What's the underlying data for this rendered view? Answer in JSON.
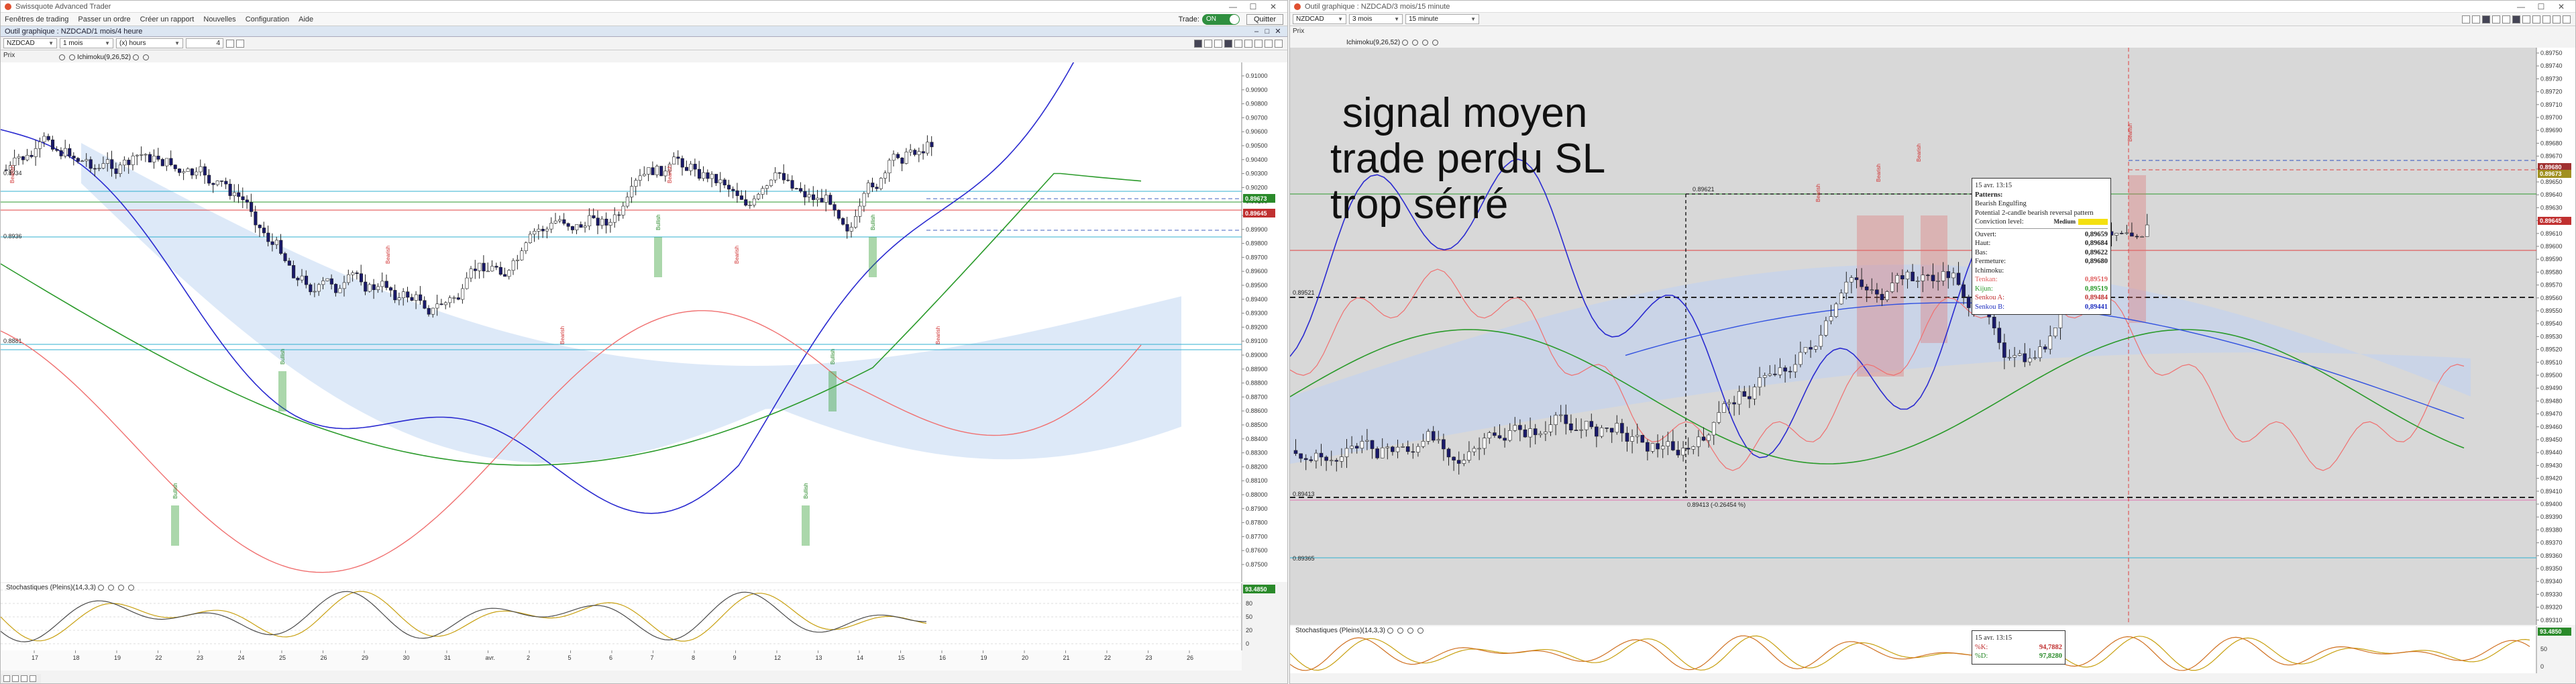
{
  "left": {
    "app_title": "Swissquote Advanced Trader",
    "menu": [
      "Fenêtres de trading",
      "Passer un ordre",
      "Créer un rapport",
      "Nouvelles",
      "Configuration",
      "Aide"
    ],
    "trade_label": "Trade:",
    "trade_state": "ON",
    "quit_label": "Quitter",
    "chart_title": "Outil graphique : NZDCAD/1 mois/4 heure",
    "symbol": "NZDCAD",
    "period": "1 mois",
    "unit": "(x) hours",
    "unit_value": "4",
    "price_label": "Prix",
    "ichimoku_label": "Ichimoku(9,26,52)",
    "stoch_label": "Stochastiques (Pleins)(14,3,3)",
    "price_ticks": [
      "0.91000",
      "0.90900",
      "0.90800",
      "0.90700",
      "0.90600",
      "0.90500",
      "0.90400",
      "0.90300",
      "0.90200",
      "0.90100",
      "0.90000",
      "0.89900",
      "0.89800",
      "0.89700",
      "0.89600",
      "0.89500",
      "0.89400",
      "0.89300",
      "0.89200",
      "0.89100",
      "0.89000",
      "0.88900",
      "0.88800",
      "0.88700",
      "0.88600",
      "0.88500",
      "0.88400",
      "0.88300",
      "0.88200",
      "0.88100",
      "0.88000",
      "0.87900",
      "0.87800",
      "0.87700",
      "0.87600",
      "0.87500"
    ],
    "level_labels": [
      "0.8934",
      "0.8936",
      "0.8881"
    ],
    "price_badges": [
      {
        "text": "0.89673",
        "color": "#2a8a2a"
      },
      {
        "text": "0.89645",
        "color": "#c03030"
      }
    ],
    "stoch_ticks": [
      "100",
      "80",
      "50",
      "20",
      "0"
    ],
    "stoch_badge": "93.4850",
    "date_ticks": [
      "17",
      "18",
      "19",
      "22",
      "23",
      "24",
      "25",
      "26",
      "29",
      "30",
      "31",
      "avr.",
      "2",
      "5",
      "6",
      "7",
      "8",
      "9",
      "12",
      "13",
      "14",
      "15",
      "16",
      "19",
      "20",
      "21",
      "22",
      "23",
      "26"
    ],
    "pattern_labels_red": [
      "Bearish",
      "Bearish",
      "Bearish",
      "Bearish",
      "Bearish",
      "Bearish"
    ],
    "pattern_labels_green": [
      "Bullish",
      "Bullish",
      "Bullish",
      "Bullish",
      "Bullish",
      "Bullish"
    ]
  },
  "right": {
    "chart_title": "Outil graphique : NZDCAD/3 mois/15 minute",
    "symbol": "NZDCAD",
    "period": "3 mois",
    "unit": "15 minute",
    "price_label": "Prix",
    "ichimoku_label": "Ichimoku(9,26,52)",
    "stoch_label": "Stochastiques (Pleins)(14,3,3)",
    "annotation": [
      "signal moyen",
      "trade perdu SL",
      "trop sérré"
    ],
    "price_ticks": [
      "0.89750",
      "0.89740",
      "0.89730",
      "0.89720",
      "0.89710",
      "0.89700",
      "0.89690",
      "0.89680",
      "0.89670",
      "0.89660",
      "0.89650",
      "0.89640",
      "0.89630",
      "0.89620",
      "0.89610",
      "0.89600",
      "0.89590",
      "0.89580",
      "0.89570",
      "0.89560",
      "0.89550",
      "0.89540",
      "0.89530",
      "0.89520",
      "0.89510",
      "0.89500",
      "0.89490",
      "0.89480",
      "0.89470",
      "0.89460",
      "0.89450",
      "0.89440",
      "0.89430",
      "0.89420",
      "0.89410",
      "0.89400",
      "0.89390",
      "0.89380",
      "0.89370",
      "0.89360",
      "0.89350",
      "0.89340",
      "0.89330",
      "0.89320",
      "0.89310"
    ],
    "level_labels": [
      "0.89621",
      "0.89413",
      "0.89365",
      "0.89521"
    ],
    "range_label": "0.89413 (-0.26454 %)",
    "price_badges": [
      {
        "text": "0.89680",
        "color": "#a03030"
      },
      {
        "text": "0.89673",
        "color": "#a09020"
      },
      {
        "text": "0.89645",
        "color": "#c03030"
      }
    ],
    "stoch_badge": "93.4850",
    "stoch_ticks": [
      "100",
      "50",
      "0"
    ],
    "tooltip": {
      "date": "15 avr. 13:15",
      "pattern_head": "Patterns:",
      "pattern_name": "Bearish Engulfing",
      "pattern_desc": "Potential 2-candle bearish reversal pattern",
      "conviction_label": "Conviction level:",
      "conviction_value": "Medium",
      "rows": [
        {
          "k": "Ouvert:",
          "v": "0,89659"
        },
        {
          "k": "Haut:",
          "v": "0,89684"
        },
        {
          "k": "Bas:",
          "v": "0,89622"
        },
        {
          "k": "Fermeture:",
          "v": "0,89680"
        }
      ],
      "ichimoku_head": "Ichimoku:",
      "ichimoku_rows": [
        {
          "k": "Tenkan:",
          "v": "0,89519",
          "color": "#e06060"
        },
        {
          "k": "Kijun:",
          "v": "0,89519",
          "color": "#2a9a2a"
        },
        {
          "k": "Senkou A:",
          "v": "0,89484",
          "color": "#c03030"
        },
        {
          "k": "Senkou B:",
          "v": "0,89441",
          "color": "#2030c0"
        }
      ]
    },
    "stoch_tooltip": {
      "date": "15 avr. 13:15",
      "rows": [
        {
          "k": "%K:",
          "v": "94,7882",
          "color": "#c03030"
        },
        {
          "k": "%D:",
          "v": "97,8280",
          "color": "#2a8a2a"
        }
      ]
    },
    "pattern_labels_red": [
      "Bearish",
      "Bearish",
      "Bearish",
      "Bearish"
    ]
  },
  "colors": {
    "green_band": "#2e9a2e",
    "red_band": "#e04040",
    "tenkan": "#f07070",
    "kijun": "#2a9a2a",
    "senkou_b": "#2a2ad0",
    "cloud": "#cfdff5",
    "cyan": "#30b0d0",
    "candle_dark": "#1a1a6a",
    "candle_light": "#ffffff"
  }
}
